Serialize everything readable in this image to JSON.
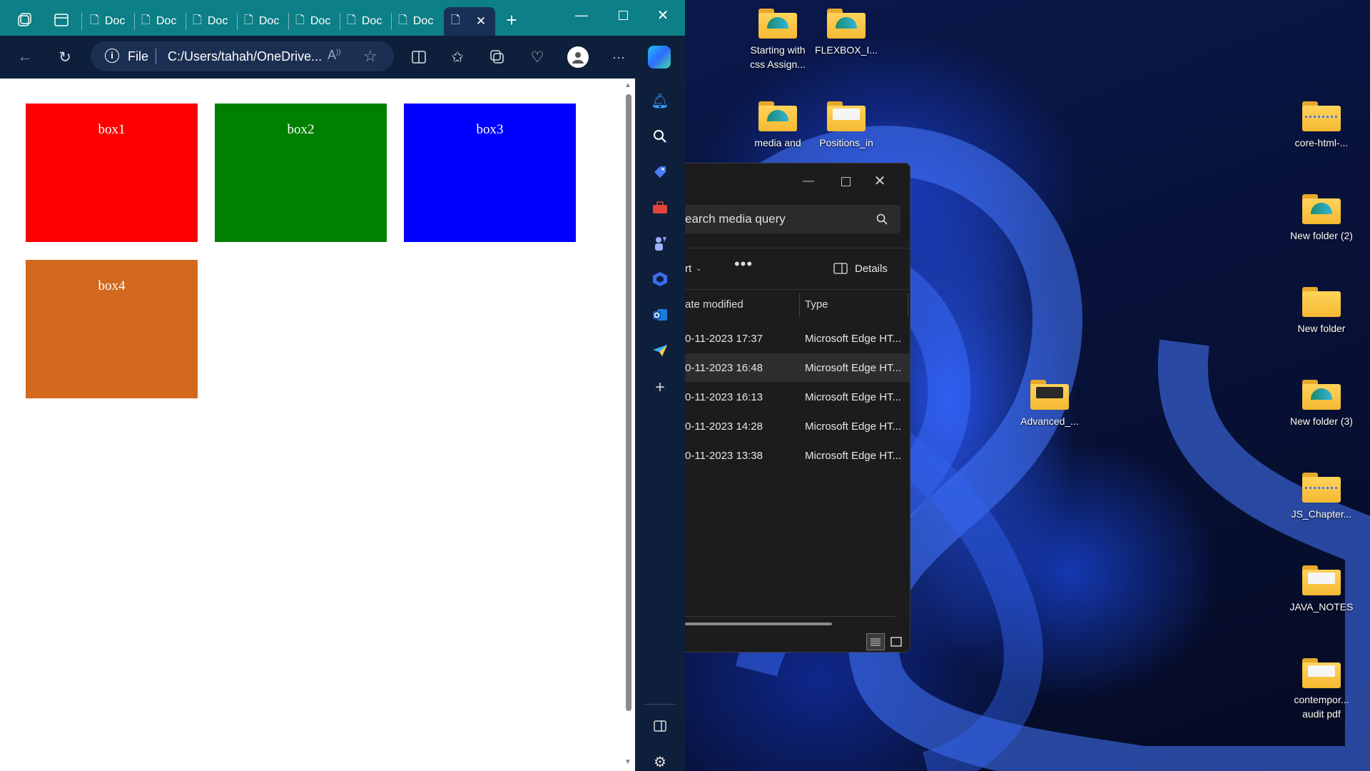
{
  "browser": {
    "tabs": [
      {
        "label": "Doc"
      },
      {
        "label": "Doc"
      },
      {
        "label": "Doc"
      },
      {
        "label": "Doc"
      },
      {
        "label": "Doc"
      },
      {
        "label": "Doc"
      },
      {
        "label": "Doc"
      }
    ],
    "address": {
      "scheme_label": "File",
      "url": "C:/Users/tahah/OneDrive..."
    },
    "page": {
      "boxes": [
        {
          "label": "box1",
          "color": "#ff0000"
        },
        {
          "label": "box2",
          "color": "#008000"
        },
        {
          "label": "box3",
          "color": "#0000ff"
        },
        {
          "label": "box4",
          "color": "#d2691e"
        }
      ]
    },
    "accent_titlebar": "#0d7f86"
  },
  "explorer": {
    "search_placeholder": "earch media query",
    "sort_label": "rt",
    "details_label": "Details",
    "columns": {
      "date": "ate modified",
      "type": "Type"
    },
    "rows": [
      {
        "date": "0-11-2023 17:37",
        "type": "Microsoft Edge HT..."
      },
      {
        "date": "0-11-2023 16:48",
        "type": "Microsoft Edge HT..."
      },
      {
        "date": "0-11-2023 16:13",
        "type": "Microsoft Edge HT..."
      },
      {
        "date": "0-11-2023 14:28",
        "type": "Microsoft Edge HT..."
      },
      {
        "date": "0-11-2023 13:38",
        "type": "Microsoft Edge HT..."
      }
    ]
  },
  "desktop": {
    "icons": [
      {
        "label": "Starting with css Assign..."
      },
      {
        "label": "FLEXBOX_I..."
      },
      {
        "label": "media and"
      },
      {
        "label": "Positions_in"
      },
      {
        "label": "Advanced_..."
      },
      {
        "label": "core-html-..."
      },
      {
        "label": "New folder (2)"
      },
      {
        "label": "New folder"
      },
      {
        "label": "New folder (3)"
      },
      {
        "label": "JS_Chapter..."
      },
      {
        "label": "JAVA_NOTES"
      },
      {
        "label": "contempor... audit pdf"
      }
    ]
  }
}
